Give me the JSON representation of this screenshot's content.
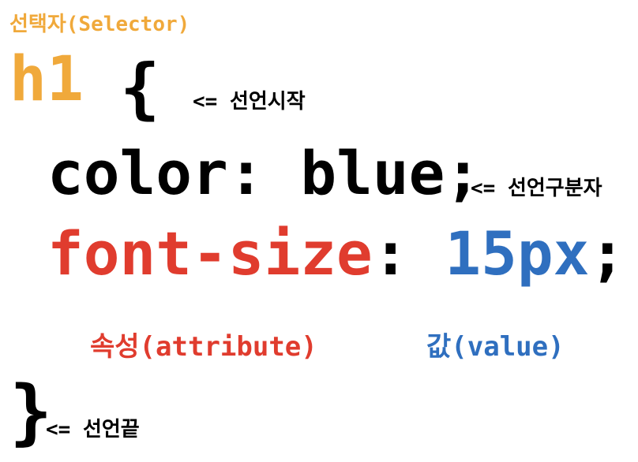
{
  "colors": {
    "selector": "#f0a93b",
    "attribute": "#e03c2e",
    "value": "#2f6fbf",
    "text": "#000000"
  },
  "selector": {
    "caption": "선택자(Selector)",
    "name": "h1"
  },
  "open_brace": "{",
  "start_note": "<= 선언시작",
  "declarations": [
    {
      "property": "color",
      "colon": ":",
      "value": "blue",
      "semicolon": ";"
    },
    {
      "property": "font-size",
      "colon": ":",
      "value": "15px",
      "semicolon": ";"
    }
  ],
  "separator_note": "<= 선언구분자",
  "attribute_caption": "속성(attribute)",
  "value_caption": "값(value)",
  "close_brace": "}",
  "end_note": "<= 선언끝"
}
